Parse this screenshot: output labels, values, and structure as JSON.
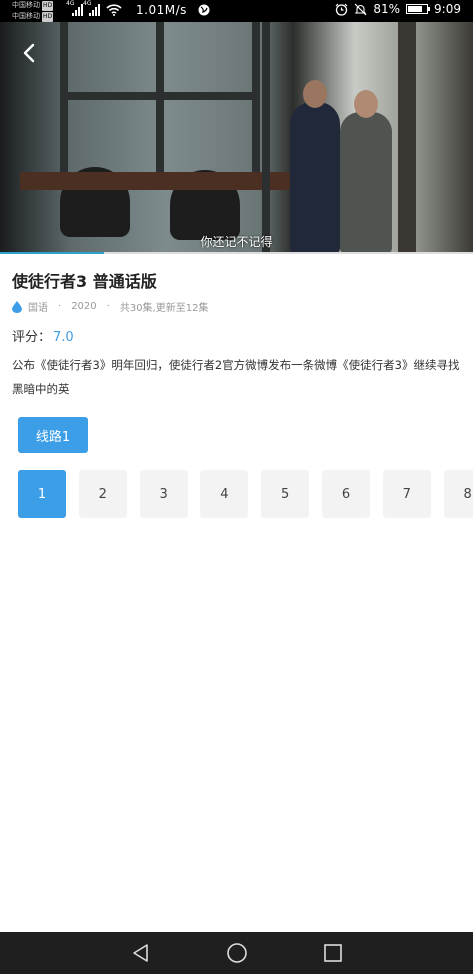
{
  "status_bar": {
    "carrier_1": "中国移动",
    "carrier_2": "中国移动",
    "hd_label": "HD",
    "net_type": "4G",
    "speed": "1.01M/s",
    "battery": "81%",
    "battery_level": 0.81,
    "time": "9:09"
  },
  "video": {
    "subtitle": "你还记不记得",
    "progress": 0.22
  },
  "detail": {
    "title": "使徒行者3 普通话版",
    "language": "国语",
    "year": "2020",
    "episodes_info": "共30集,更新至12集",
    "dot": "·",
    "rating_label": "评分：",
    "rating_value": "7.0",
    "description": "公布《使徒行者3》明年回归，使徒行者2官方微博发布一条微博《使徒行者3》继续寻找黑暗中的英"
  },
  "route": {
    "label": "线路1"
  },
  "episodes": [
    "1",
    "2",
    "3",
    "4",
    "5",
    "6",
    "7",
    "8"
  ],
  "selected_episode": "1",
  "colors": {
    "accent": "#3d9ee8",
    "progress": "#2ea1c8"
  },
  "icons": {
    "back": "back-arrow-icon",
    "language": "drop-icon",
    "nav_back": "triangle-back-icon",
    "nav_home": "circle-home-icon",
    "nav_recent": "square-recent-icon"
  }
}
